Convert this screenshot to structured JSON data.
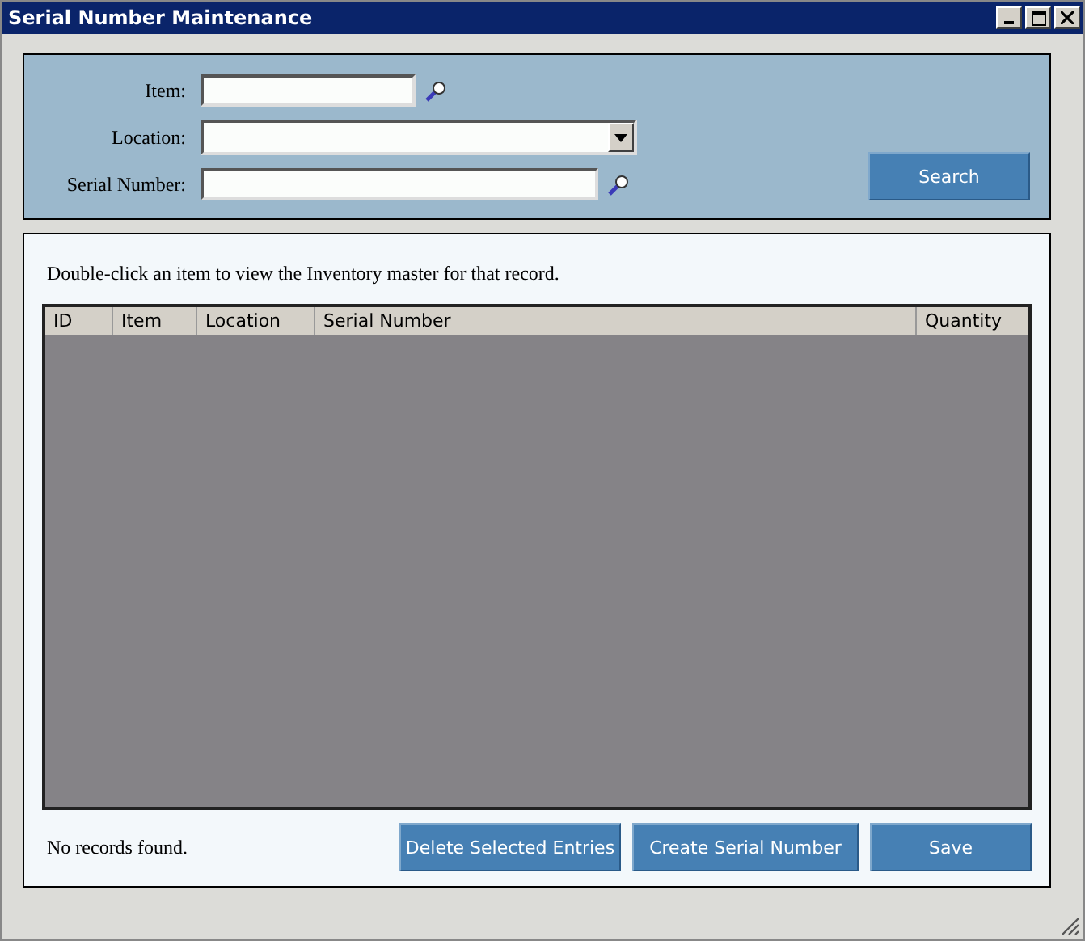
{
  "window": {
    "title": "Serial Number Maintenance"
  },
  "search_panel": {
    "fields": [
      {
        "kind": "lookup",
        "label": "Item:"
      },
      {
        "kind": "dropdown",
        "label": "Location:"
      },
      {
        "kind": "lookup",
        "label": "Serial Number:"
      }
    ],
    "search_button": "Search"
  },
  "results_panel": {
    "hint": "Double-click an item to view the Inventory master for that record.",
    "table": {
      "columns": [
        "ID",
        "Item",
        "Location",
        "Serial Number",
        "Quantity"
      ]
    },
    "status": "No records found.",
    "buttons": [
      "Delete Selected Entries",
      "Create Serial Number",
      "Save"
    ]
  }
}
